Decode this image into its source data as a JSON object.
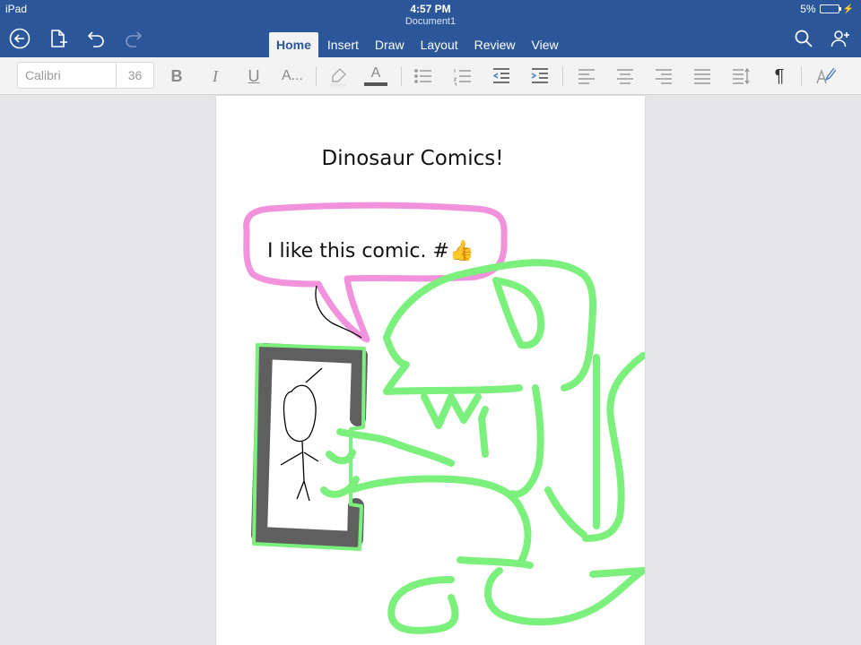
{
  "status": {
    "device": "iPad",
    "time": "4:57 PM",
    "battery": "5%",
    "battery_level": 0.05
  },
  "document": {
    "name": "Document1",
    "title": "Dinosaur Comics!",
    "speech_text": "I like this comic. #👍"
  },
  "tabs": [
    {
      "label": "Home",
      "active": true
    },
    {
      "label": "Insert",
      "active": false
    },
    {
      "label": "Draw",
      "active": false
    },
    {
      "label": "Layout",
      "active": false
    },
    {
      "label": "Review",
      "active": false
    },
    {
      "label": "View",
      "active": false
    }
  ],
  "ribbon": {
    "font_name_placeholder": "Calibri",
    "font_size_placeholder": "36",
    "bold": "B",
    "italic": "I",
    "underline": "U",
    "font_effects": "A...",
    "font_color": "A",
    "pilcrow": "¶"
  },
  "colors": {
    "app_bar": "#2b579a",
    "ribbon_bg": "#f3f3f3",
    "canvas_bg": "#e6e6e9",
    "ink_green": "#7cf07c",
    "ink_pink": "#f292dc",
    "ink_gray": "#5f5f5f"
  },
  "icons": [
    "back-icon",
    "document-menu-icon",
    "undo-icon",
    "redo-icon",
    "search-icon",
    "share-person-icon"
  ]
}
